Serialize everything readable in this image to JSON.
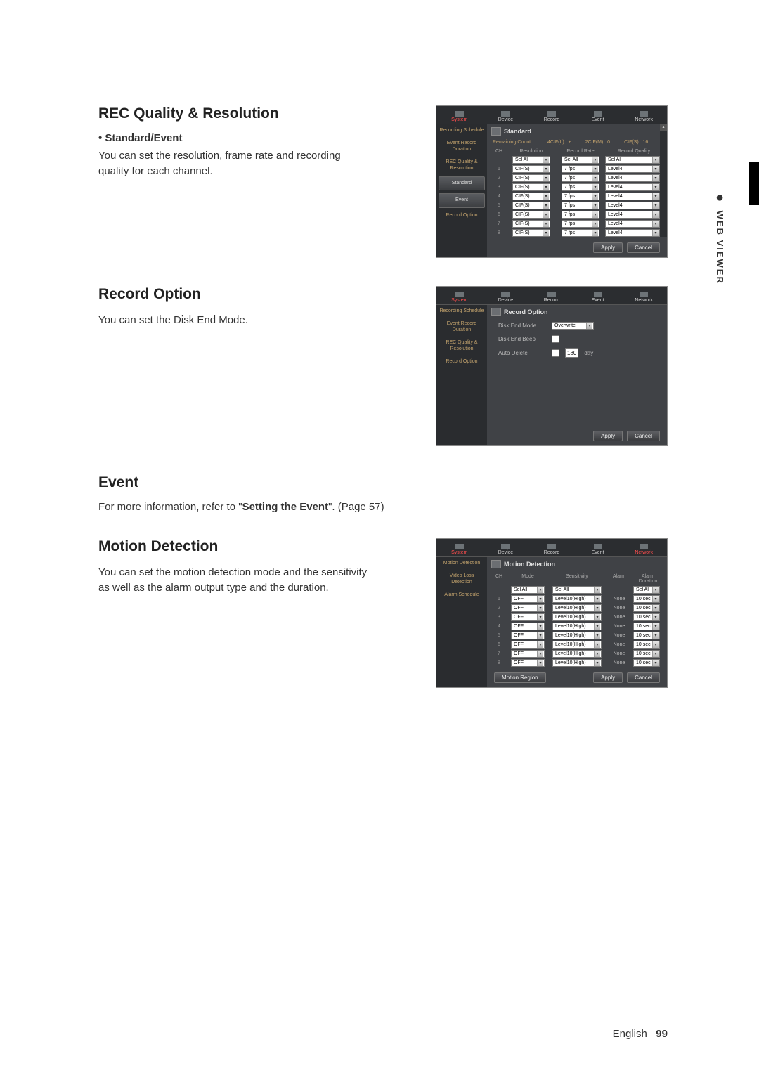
{
  "headings": {
    "rec_quality": "REC Quality & Resolution",
    "record_option": "Record Option",
    "event": "Event",
    "motion_detection": "Motion Detection"
  },
  "bullets": {
    "standard_event": "Standard/Event"
  },
  "body": {
    "rec_quality": "You can set the resolution, frame rate and recording quality for each channel.",
    "record_option": "You can set the Disk End Mode.",
    "event_ref_a": "For more information, refer to \"",
    "event_ref_b": "Setting the Event",
    "event_ref_c": "\". (Page 57)",
    "motion": "You can set the motion detection mode and the sensitivity as well as the alarm output type and the duration."
  },
  "side_tab": "WEB VIEWER",
  "footer_lang": "English",
  "footer_page": "_99",
  "tabs": {
    "system": "System",
    "device": "Device",
    "record": "Record",
    "event": "Event",
    "network": "Network"
  },
  "sidebar_rec": {
    "recording_schedule": "Recording Schedule",
    "event_record_duration": "Event Record Duration",
    "rec_quality": "REC Quality & Resolution",
    "standard": "Standard",
    "event": "Event",
    "record_option": "Record Option"
  },
  "sidebar_evt": {
    "motion_detection": "Motion Detection",
    "video_loss": "Video Loss Detection",
    "alarm_schedule": "Alarm Schedule"
  },
  "standard_panel": {
    "title": "Standard",
    "remaining": "Remaining Count :",
    "r1": "4CIF(L) :",
    "r1v": "+",
    "r2": "2CIF(M) :",
    "r2v": "0",
    "r3": "CIF(S) :",
    "r3v": "16",
    "th_ch": "CH",
    "th_res": "Resolution",
    "th_rate": "Record Rate",
    "th_qual": "Record Quality",
    "sel_all": "Sel All",
    "rows": [
      {
        "ch": "1",
        "res": "CIF(S)",
        "rate": "7 fps",
        "qual": "Level4"
      },
      {
        "ch": "2",
        "res": "CIF(S)",
        "rate": "7 fps",
        "qual": "Level4"
      },
      {
        "ch": "3",
        "res": "CIF(S)",
        "rate": "7 fps",
        "qual": "Level4"
      },
      {
        "ch": "4",
        "res": "CIF(S)",
        "rate": "7 fps",
        "qual": "Level4"
      },
      {
        "ch": "5",
        "res": "CIF(S)",
        "rate": "7 fps",
        "qual": "Level4"
      },
      {
        "ch": "6",
        "res": "CIF(S)",
        "rate": "7 fps",
        "qual": "Level4"
      },
      {
        "ch": "7",
        "res": "CIF(S)",
        "rate": "7 fps",
        "qual": "Level4"
      },
      {
        "ch": "8",
        "res": "CIF(S)",
        "rate": "7 fps",
        "qual": "Level4"
      }
    ]
  },
  "record_option_panel": {
    "title": "Record Option",
    "disk_end_mode": "Disk End Mode",
    "disk_end_mode_v": "Overwrite",
    "disk_end_beep": "Disk End Beep",
    "auto_delete": "Auto Delete",
    "auto_delete_v": "180",
    "auto_delete_unit": "day"
  },
  "motion_panel": {
    "title": "Motion Detection",
    "th_ch": "CH",
    "th_mode": "Mode",
    "th_sens": "Sensitivity",
    "th_alarm": "Alarm",
    "th_dur": "Alarm Duration",
    "sel_all": "Sel All",
    "rows": [
      {
        "ch": "1",
        "mode": "OFF",
        "sens": "Level10(High)",
        "alarm": "None",
        "dur": "10 sec"
      },
      {
        "ch": "2",
        "mode": "OFF",
        "sens": "Level10(High)",
        "alarm": "None",
        "dur": "10 sec"
      },
      {
        "ch": "3",
        "mode": "OFF",
        "sens": "Level10(High)",
        "alarm": "None",
        "dur": "10 sec"
      },
      {
        "ch": "4",
        "mode": "OFF",
        "sens": "Level10(High)",
        "alarm": "None",
        "dur": "10 sec"
      },
      {
        "ch": "5",
        "mode": "OFF",
        "sens": "Level10(High)",
        "alarm": "None",
        "dur": "10 sec"
      },
      {
        "ch": "6",
        "mode": "OFF",
        "sens": "Level10(High)",
        "alarm": "None",
        "dur": "10 sec"
      },
      {
        "ch": "7",
        "mode": "OFF",
        "sens": "Level10(High)",
        "alarm": "None",
        "dur": "10 sec"
      },
      {
        "ch": "8",
        "mode": "OFF",
        "sens": "Level10(High)",
        "alarm": "None",
        "dur": "10 sec"
      }
    ],
    "motion_region": "Motion Region"
  },
  "buttons": {
    "apply": "Apply",
    "cancel": "Cancel"
  }
}
